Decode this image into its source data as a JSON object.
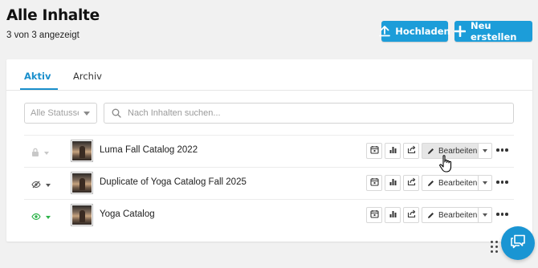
{
  "header": {
    "title": "Alle Inhalte",
    "subtitle": "3 von 3 angezeigt",
    "upload_label": "Hochladen",
    "new_label": "Neu erstellen"
  },
  "tabs": [
    {
      "label": "Aktiv",
      "active": true
    },
    {
      "label": "Archiv",
      "active": false
    }
  ],
  "filters": {
    "status_select_value": "Alle Statussen",
    "search_placeholder": "Nach Inhalten suchen..."
  },
  "rows": [
    {
      "title": "Luma Fall Catalog 2022",
      "status_icon": "lock-icon",
      "edit_label": "Bearbeiten"
    },
    {
      "title": "Duplicate of Yoga Catalog Fall 2025",
      "status_icon": "eye-off-icon",
      "edit_label": "Bearbeiten"
    },
    {
      "title": "Yoga Catalog",
      "status_icon": "eye-icon",
      "edit_label": "Bearbeiten"
    }
  ],
  "colors": {
    "accent": "#1c9dd9",
    "active_tab": "#1a8fcc",
    "published_green": "#2db34a",
    "background": "#f1f1f1"
  }
}
